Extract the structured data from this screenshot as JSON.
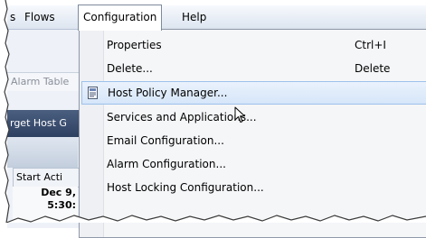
{
  "menubar": {
    "items": [
      {
        "label": "s"
      },
      {
        "label": "Flows"
      },
      {
        "label": "Configuration"
      },
      {
        "label": "Help"
      }
    ]
  },
  "background": {
    "alarm_tab": "Alarm Table",
    "target_host": "rget Host G",
    "column_header": "Start Acti",
    "cell_line1": "Dec 9,",
    "cell_line2": "5:30:"
  },
  "menu": {
    "items": [
      {
        "label": "Properties",
        "shortcut": "Ctrl+I"
      },
      {
        "label": "Delete...",
        "shortcut": "Delete"
      },
      {
        "label": "Host Policy Manager...",
        "shortcut": "",
        "highlighted": true,
        "icon": "document-icon"
      },
      {
        "label": "Services and Applications...",
        "shortcut": ""
      },
      {
        "label": "Email Configuration...",
        "shortcut": ""
      },
      {
        "label": "Alarm Configuration...",
        "shortcut": ""
      },
      {
        "label": "Host Locking Configuration...",
        "shortcut": ""
      }
    ]
  },
  "colors": {
    "menu_bg": "#f5f6f8",
    "highlight": "#d6e6f9",
    "highlight_border": "#9ec1ea",
    "target_bar": "#2f4161"
  }
}
